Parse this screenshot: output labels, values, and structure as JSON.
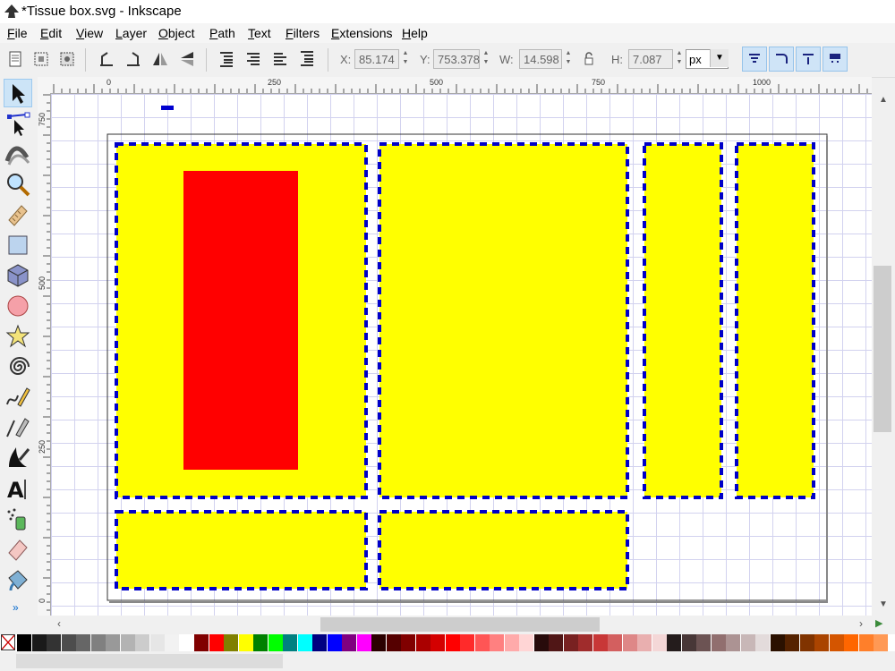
{
  "window": {
    "title": "*Tissue box.svg - Inkscape"
  },
  "menu": [
    "File",
    "Edit",
    "View",
    "Layer",
    "Object",
    "Path",
    "Text",
    "Filters",
    "Extensions",
    "Help"
  ],
  "toolbar": {
    "x_label": "X:",
    "x_value": "85.174",
    "y_label": "Y:",
    "y_value": "753.378",
    "w_label": "W:",
    "w_value": "14.598",
    "h_label": "H:",
    "h_value": "7.087",
    "unit": "px"
  },
  "ruler": {
    "h_labels": [
      "0",
      "250",
      "500",
      "750",
      "1000"
    ],
    "v_labels": [
      "750",
      "500",
      "250",
      "0"
    ]
  },
  "tools": [
    "selector-tool",
    "node-tool",
    "tweak-tool",
    "zoom-tool",
    "measure-tool",
    "rectangle-tool",
    "3d-box-tool",
    "ellipse-tool",
    "star-tool",
    "spiral-tool",
    "pencil-tool",
    "pen-tool",
    "calligraphy-tool",
    "text-tool",
    "spray-tool",
    "eraser-tool",
    "paint-bucket-tool"
  ],
  "colors": {
    "panel_fill": "#ffff00",
    "panel_stroke": "#0000c8",
    "cutout_fill": "#ff0000",
    "selection": "#0000d0"
  },
  "palette": [
    "#000000",
    "#1a1a1a",
    "#333333",
    "#4d4d4d",
    "#666666",
    "#808080",
    "#999999",
    "#b3b3b3",
    "#cccccc",
    "#e6e6e6",
    "#f2f2f2",
    "#ffffff",
    "#800000",
    "#ff0000",
    "#808000",
    "#ffff00",
    "#008000",
    "#00ff00",
    "#008080",
    "#00ffff",
    "#000080",
    "#0000ff",
    "#800080",
    "#ff00ff",
    "#2b0000",
    "#550000",
    "#800000",
    "#aa0000",
    "#d40000",
    "#ff0000",
    "#ff2a2a",
    "#ff5555",
    "#ff8080",
    "#ffaaaa",
    "#ffd5d5",
    "#280b0b",
    "#501616",
    "#782121",
    "#a02c2c",
    "#c83737",
    "#d35f5f",
    "#de8787",
    "#e9afaf",
    "#f4d7d7",
    "#241c1c",
    "#483737",
    "#6c5353",
    "#916f6f",
    "#ac9393",
    "#c8b7b7",
    "#e3dbdb",
    "#2b1100",
    "#552200",
    "#803300",
    "#aa4400",
    "#d45500",
    "#ff6600",
    "#ff7f2a",
    "#ff9955"
  ]
}
